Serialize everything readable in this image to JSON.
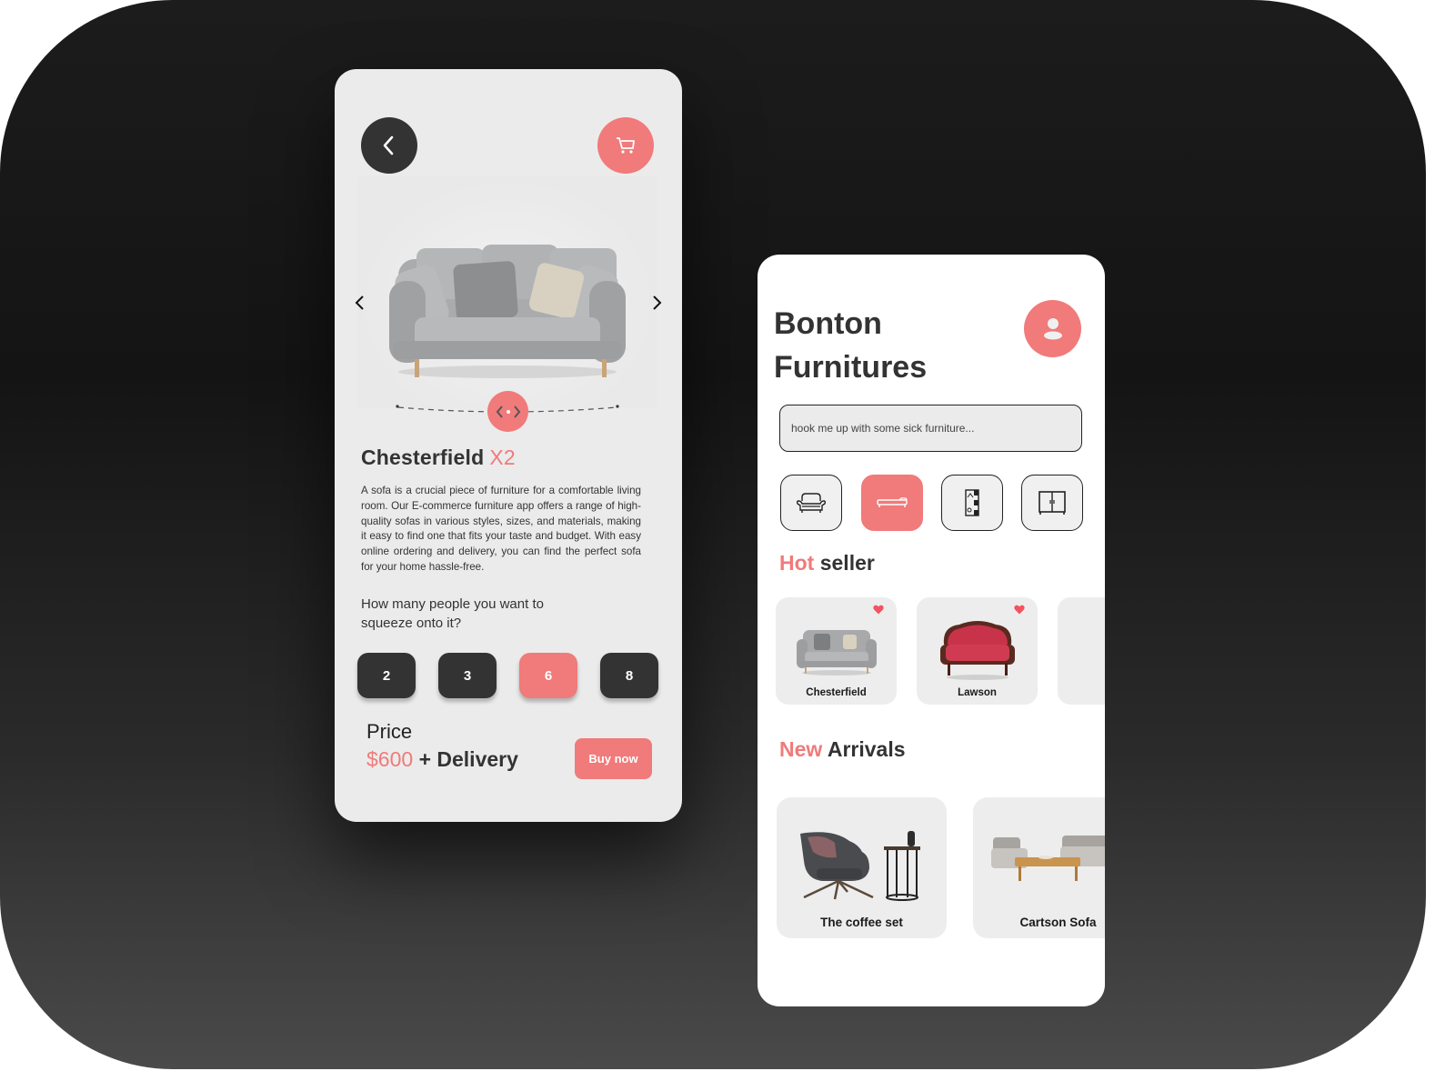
{
  "colors": {
    "accent": "#f17a7a",
    "dark": "#333333",
    "panel_left": "#ebebeb",
    "panel_right": "#ffffff"
  },
  "product_screen": {
    "back_icon": "chevron-left-icon",
    "cart_icon": "shopping-cart-icon",
    "carousel": {
      "prev_icon": "chevron-left-icon",
      "next_icon": "chevron-right-icon",
      "rotate_icon": "rotate-360-icon"
    },
    "title": "Chesterfield",
    "title_suffix": "X2",
    "description": "A sofa is a crucial piece of furniture for a comfortable living room. Our E-commerce furniture app offers a range of high-quality sofas in various styles, sizes, and materials, making it easy to find one that fits your taste and budget. With easy online ordering and delivery, you can find the perfect sofa for your home hassle-free.",
    "question": "How many people you want to squeeze onto it?",
    "seat_options": [
      {
        "label": "2",
        "selected": false
      },
      {
        "label": "3",
        "selected": false
      },
      {
        "label": "6",
        "selected": true
      },
      {
        "label": "8",
        "selected": false
      }
    ],
    "price_label": "Price",
    "price_amount": "$600",
    "price_suffix": "+ Delivery",
    "buy_button": "Buy now"
  },
  "home_screen": {
    "brand_line1": "Bonton",
    "brand_line2": "Furnitures",
    "avatar_icon": "user-icon",
    "search_placeholder": "hook me up with some sick furniture...",
    "categories": [
      {
        "icon": "armchair-icon",
        "selected": false
      },
      {
        "icon": "bed-icon",
        "selected": true
      },
      {
        "icon": "wardrobe-icon",
        "selected": false
      },
      {
        "icon": "cabinet-icon",
        "selected": false
      }
    ],
    "hot_seller": {
      "accent_word": "Hot",
      "rest": "seller",
      "items": [
        {
          "name": "Chesterfield",
          "favorited": true
        },
        {
          "name": "Lawson",
          "favorited": true
        },
        {
          "name": "",
          "favorited": false
        }
      ]
    },
    "new_arrivals": {
      "accent_word": "New",
      "rest": "Arrivals",
      "items": [
        {
          "name": "The coffee set"
        },
        {
          "name": "Cartson Sofa"
        }
      ]
    }
  }
}
